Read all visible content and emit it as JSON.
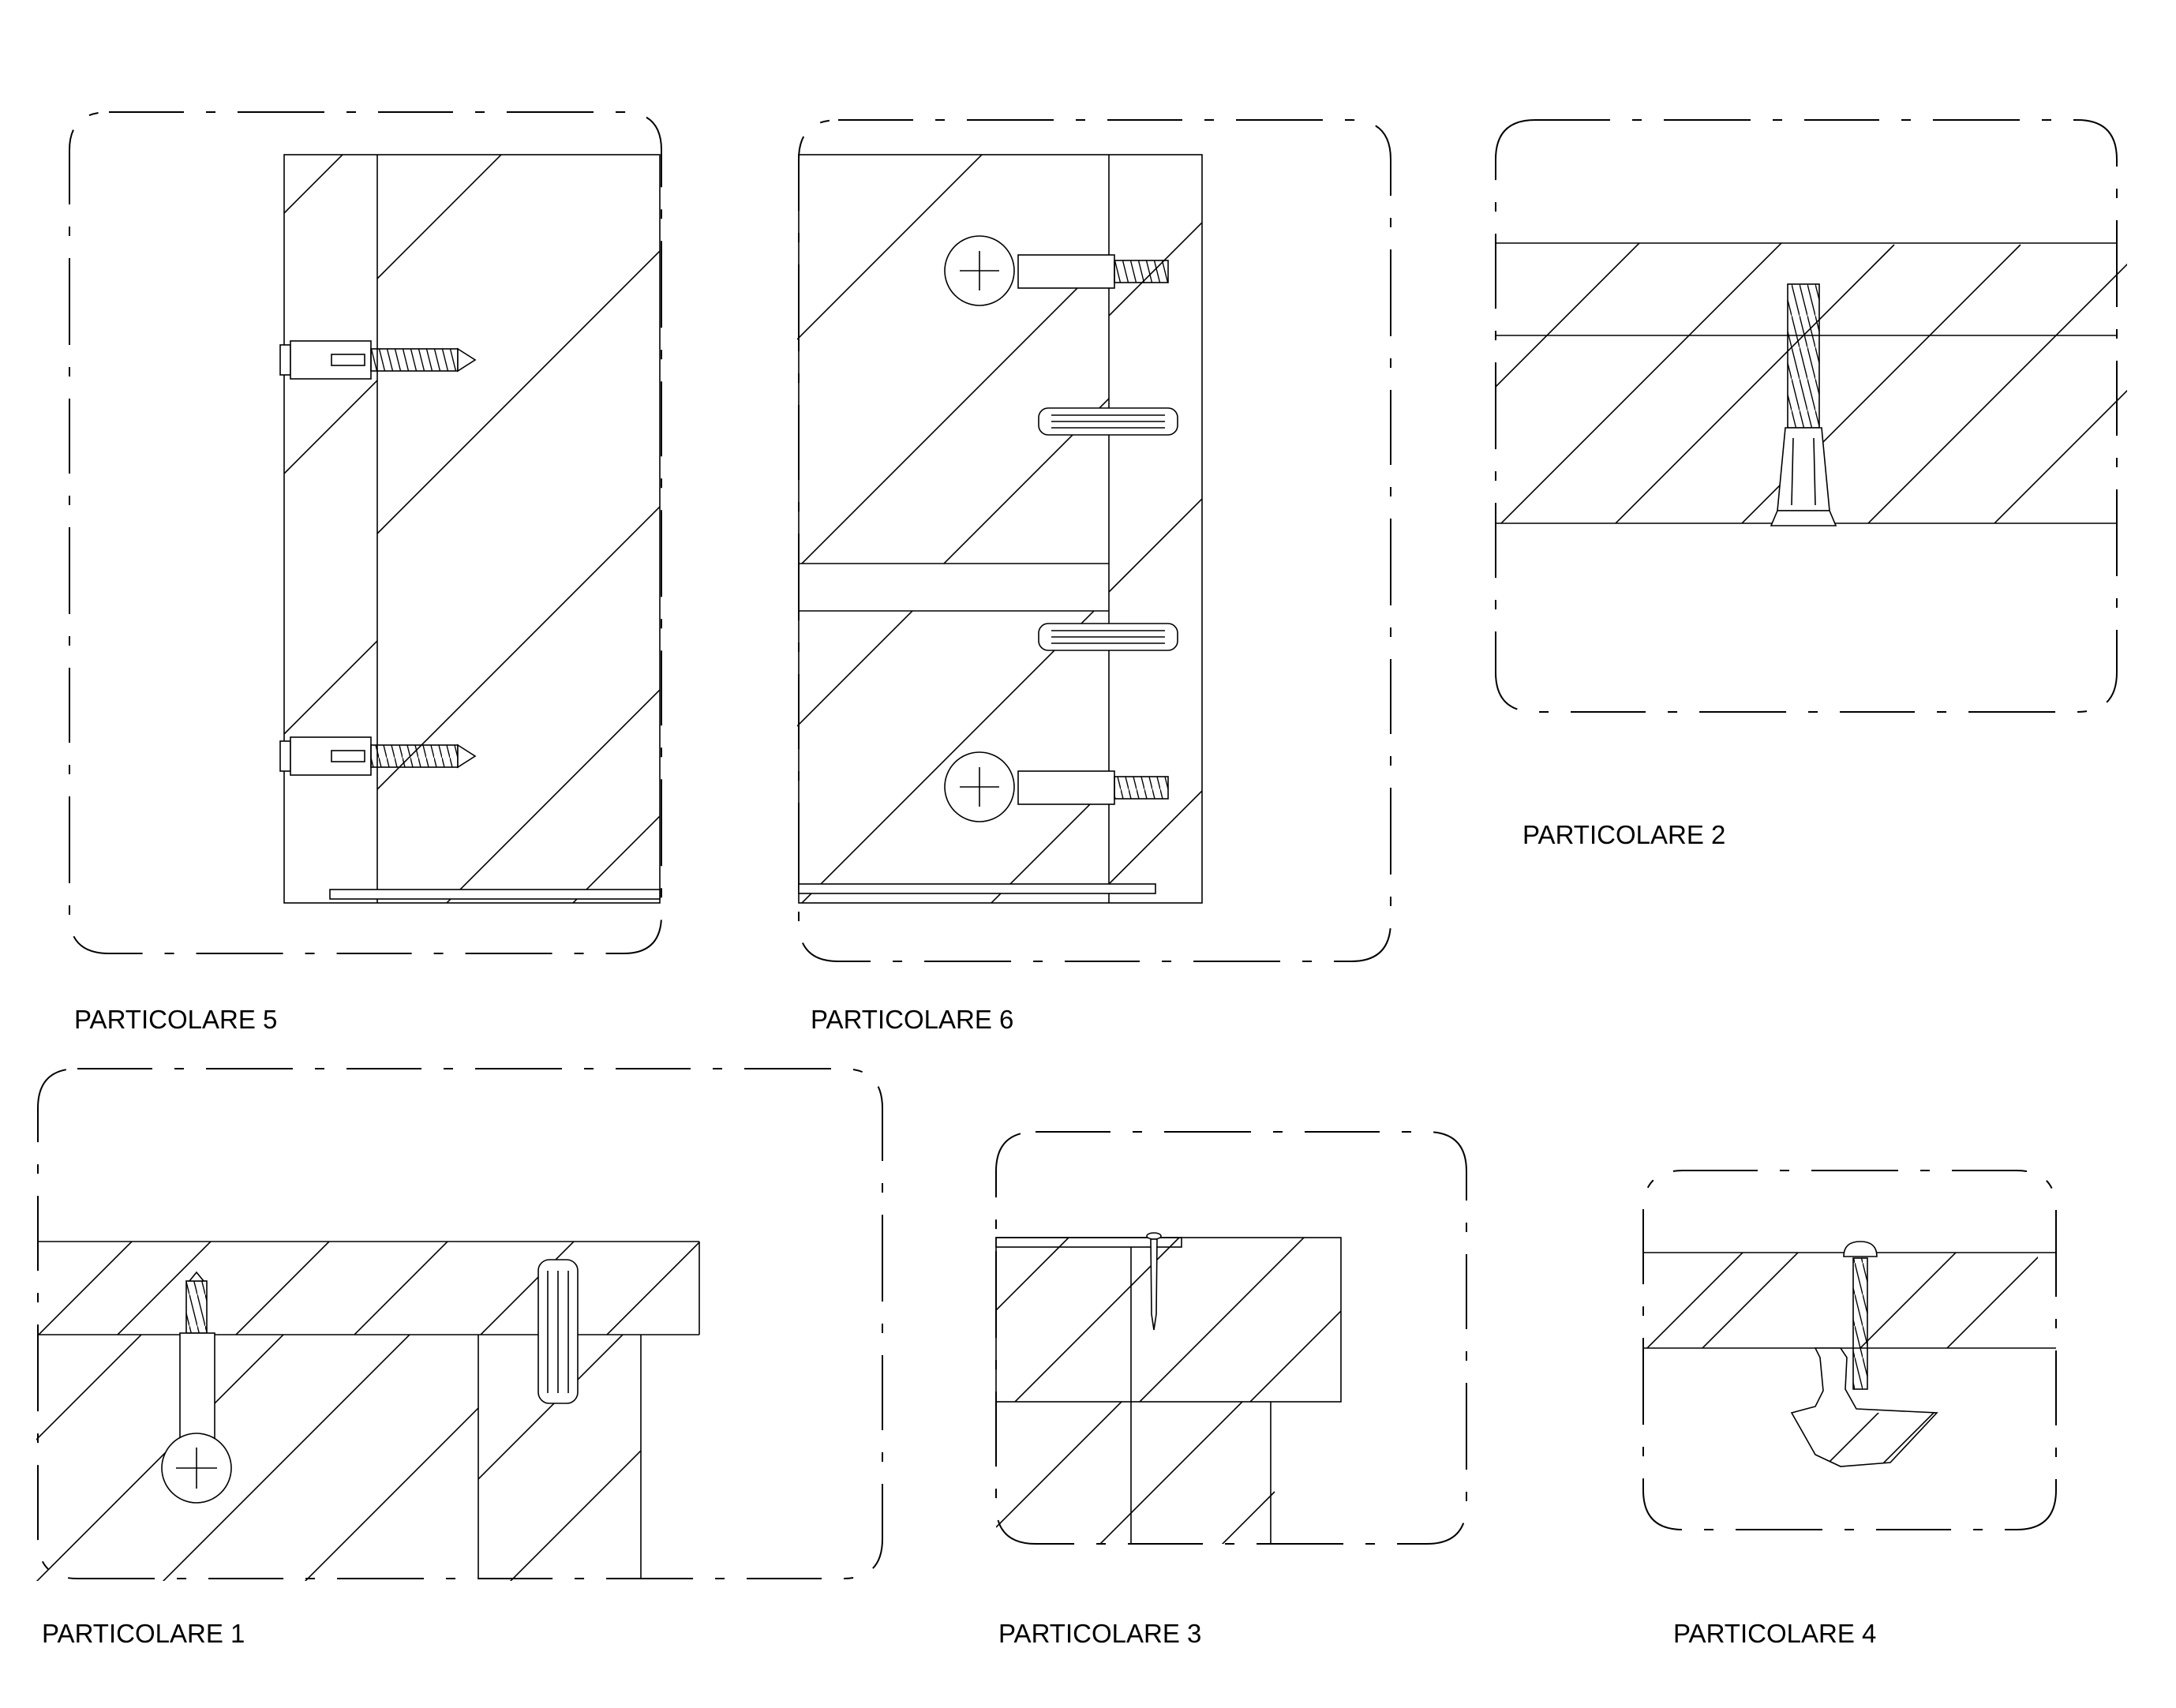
{
  "details": [
    {
      "id": "p5",
      "label": "PARTICOLARE 5"
    },
    {
      "id": "p6",
      "label": "PARTICOLARE 6"
    },
    {
      "id": "p2",
      "label": "PARTICOLARE 2"
    },
    {
      "id": "p1",
      "label": "PARTICOLARE 1"
    },
    {
      "id": "p3",
      "label": "PARTICOLARE 3"
    },
    {
      "id": "p4",
      "label": "PARTICOLARE 4"
    }
  ],
  "colors": {
    "line": "#000000",
    "background": "#ffffff"
  },
  "icons": [
    "wood-screw-icon",
    "cam-lock-icon",
    "wooden-dowel-icon",
    "nail-icon",
    "bolt-icon",
    "leveling-foot-icon"
  ]
}
